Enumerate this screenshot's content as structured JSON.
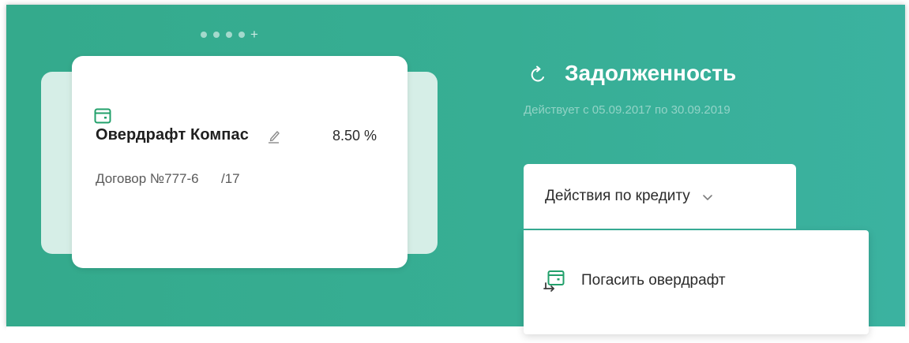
{
  "pager": {
    "dot_count": 4,
    "add_symbol": "+"
  },
  "card": {
    "icon": "wallet-icon",
    "title": "Овердрафт Компас",
    "edit_icon": "pencil-icon",
    "rate": "8.50 %",
    "contract": "Договор №777-6      /17"
  },
  "debt": {
    "icon": "refresh-icon",
    "title": "Задолженность",
    "validity": "Действует с 05.09.2017 по 30.09.2019"
  },
  "actions": {
    "label": "Действия по кредиту",
    "icon": "chevron-down-icon",
    "menu": [
      {
        "icon": "payoff-icon",
        "label": "Погасить овердрафт"
      }
    ]
  },
  "colors": {
    "panel": "#36ad90",
    "accent": "#22a06b",
    "card_back": "#d6eee7"
  }
}
